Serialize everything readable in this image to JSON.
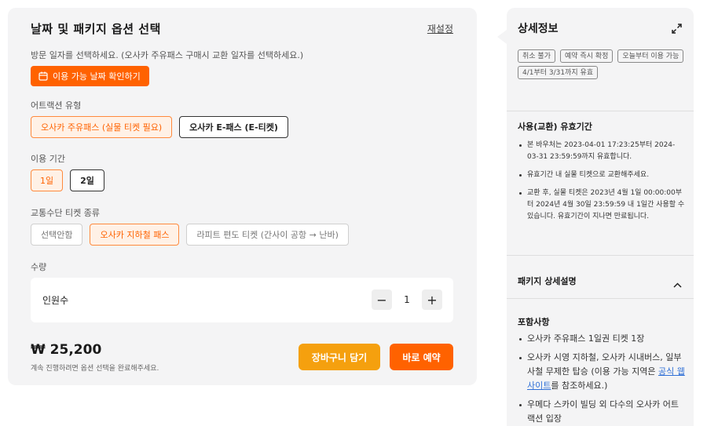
{
  "options_panel": {
    "title": "날짜 및 패키지 옵션 선택",
    "reset_label": "재설정",
    "visit_hint": "방문 일자를 선택하세요. (오사카 주유패스 구매시 교환 일자를 선택하세요.)",
    "date_button_label": "이용 가능 날짜 확인하기",
    "attraction": {
      "label": "어트랙션 유형",
      "options": [
        "오사카 주유패스 (실물 티켓 필요)",
        "오사카 E-패스 (E-티켓)"
      ]
    },
    "duration": {
      "label": "이용 기간",
      "options": [
        "1일",
        "2일"
      ]
    },
    "transport": {
      "label": "교통수단 티켓 종류",
      "options": [
        "선택안함",
        "오사카 지하철 패스",
        "라피트 편도 티켓 (간사이 공항 → 난바)"
      ]
    },
    "quantity": {
      "label": "수량",
      "row_label": "인원수",
      "value": "1",
      "minus": "−",
      "plus": "+"
    },
    "price": "₩ 25,200",
    "price_note": "계속 진행하려면 옵션 선택을 완료해주세요.",
    "cart_button": "장바구니 담기",
    "book_button": "바로 예약"
  },
  "details_panel": {
    "title": "상세정보",
    "tags": [
      "취소 불가",
      "예약 즉시 확정",
      "오늘부터 이용 가능",
      "4/1부터 3/31까지 유효"
    ],
    "validity_title": "사용(교환) 유효기간",
    "validity_items": [
      "본 바우처는 2023-04-01 17:23:25부터 2024-03-31 23:59:59까지 유효합니다.",
      "유효기간 내 실물 티켓으로 교환해주세요.",
      "교환 후, 실물 티켓은 2023년 4월 1일 00:00:00부터 2024년 4월 30일 23:59:59 내 1일간 사용할 수 있습니다. 유효기간이 지나면 만료됩니다."
    ],
    "package_title": "패키지 상세설명",
    "included_title": "포함사항",
    "included_items": {
      "item1": "오사카 주유패스 1일권 티켓 1장",
      "item2_before": "오사카 시영 지하철, 오사카 시내버스, 일부 사철 무제한 탑승 (이용 가능 지역은 ",
      "item2_link": "공식 웹사이트",
      "item2_after": "를 참조하세요.)",
      "item3": "우메다 스카이 빌딩 외 다수의 오사카 어트랙션 입장"
    }
  },
  "colors": {
    "accent": "#ff6200",
    "cart": "#f5a00e",
    "panel_bg": "#f4f4f5",
    "selected_bg": "#fff1e6",
    "link": "#2f6fd6"
  }
}
